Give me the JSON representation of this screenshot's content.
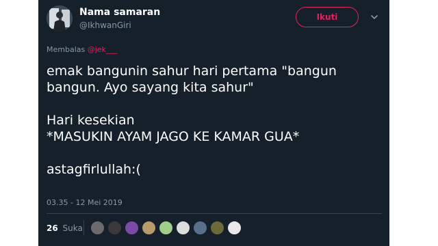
{
  "tweet": {
    "author": {
      "display_name": "Nama samaran",
      "handle": "@IkhwanGiri",
      "avatar_icon": "person-avatar"
    },
    "follow_label": "Ikuti",
    "menu_icon": "chevron-down-icon",
    "reply": {
      "prefix": "Membalas",
      "mention": "@jek___"
    },
    "text_lines": [
      "emak bangunin sahur hari pertama \"bangun",
      "bangun. Ayo sayang kita sahur\"",
      "",
      "Hari kesekian",
      "*MASUKIN AYAM JAGO KE KAMAR GUA*",
      "",
      "astagfirlullah:("
    ],
    "timestamp": "03.35 - 12 Mei 2019",
    "likes": {
      "count": "26",
      "label": "Suka",
      "avatar_colors": [
        "#6b6b6b",
        "#3a3a3a",
        "#7b4aa8",
        "#b89b6a",
        "#9fcf8a",
        "#dcdcdc",
        "#5a6f8c",
        "#6c6a3a",
        "#e8e8e8"
      ]
    },
    "colors": {
      "background": "#15202b",
      "accent": "#e0245e",
      "secondary_text": "#8899a6"
    }
  }
}
